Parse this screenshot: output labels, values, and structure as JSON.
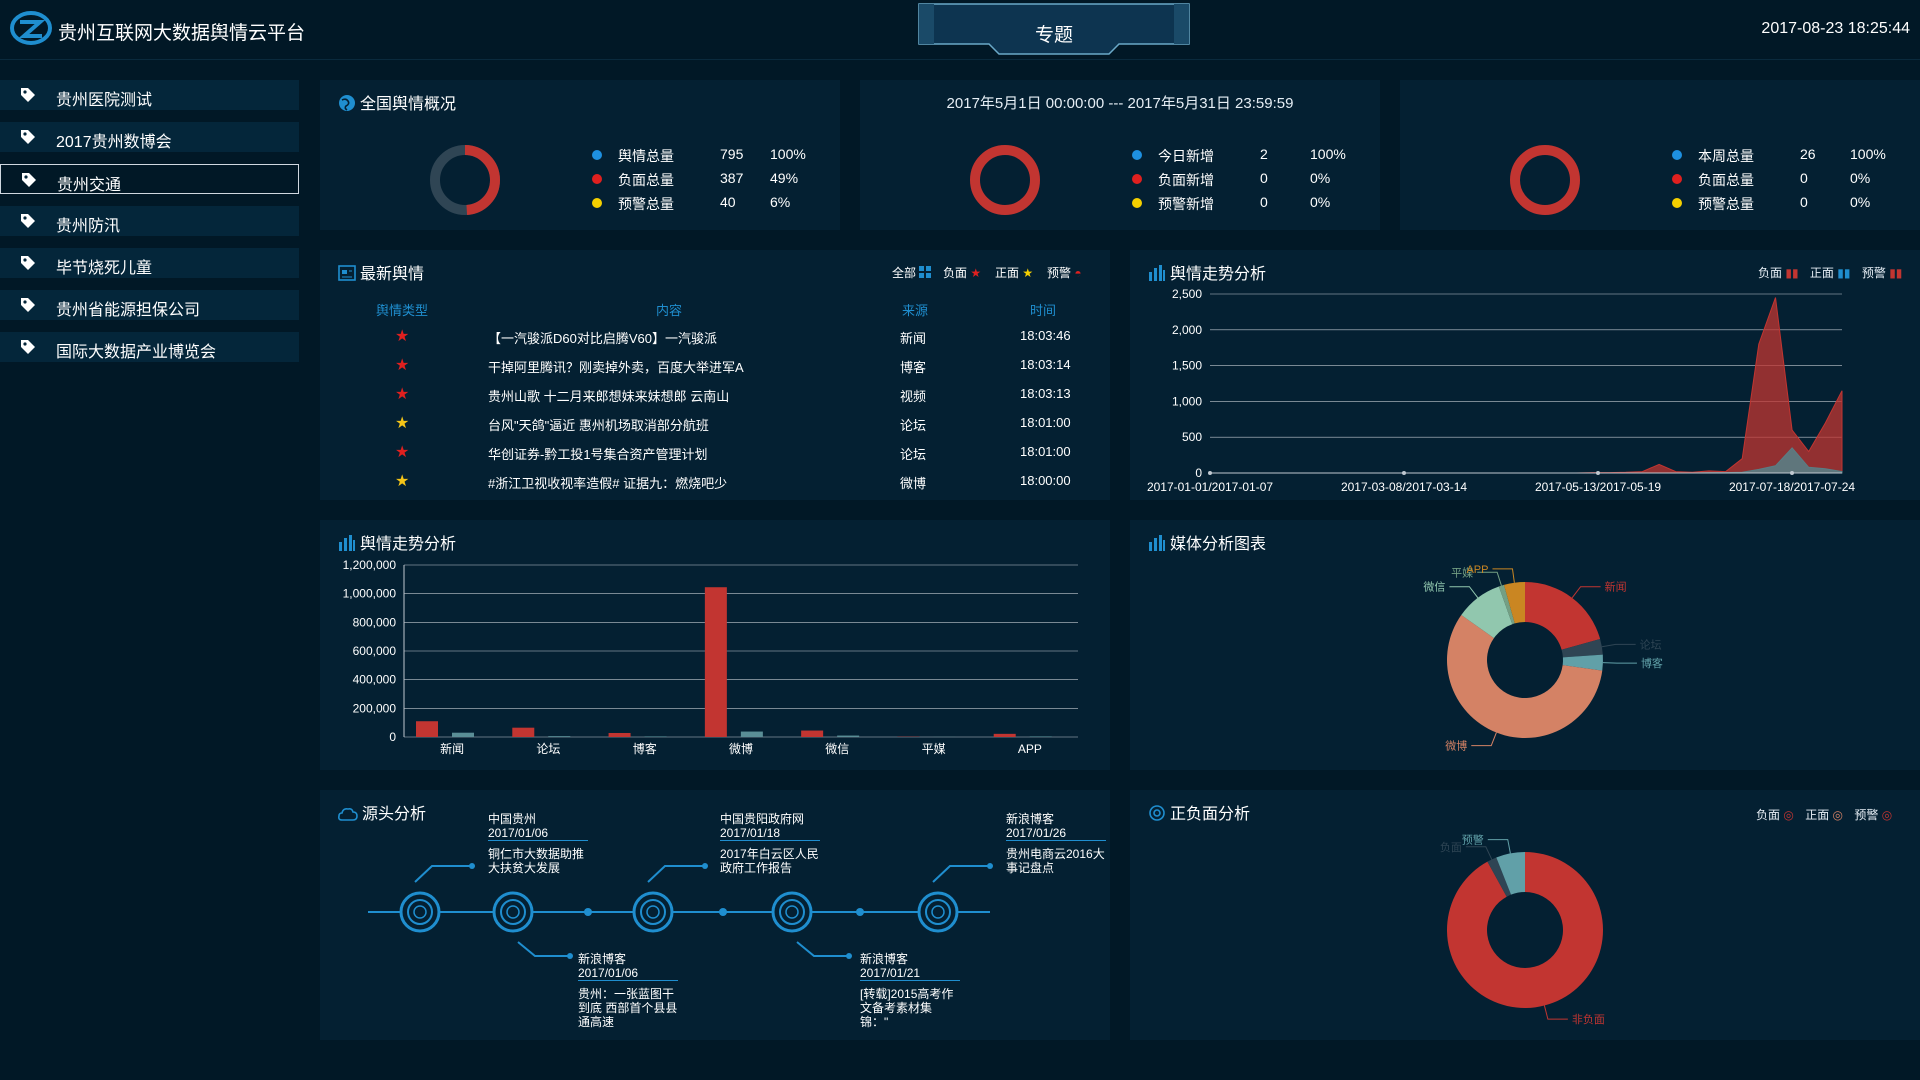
{
  "header": {
    "title": "贵州互联网大数据舆情云平台",
    "center_tab": "专题",
    "datetime": "2017-08-23 18:25:44"
  },
  "sidebar": {
    "items": [
      {
        "label": "贵州医院测试",
        "active": false
      },
      {
        "label": "2017贵州数博会",
        "active": false
      },
      {
        "label": "贵州交通",
        "active": true
      },
      {
        "label": "贵州防汛",
        "active": false
      },
      {
        "label": "毕节烧死儿童",
        "active": false
      },
      {
        "label": "贵州省能源担保公司",
        "active": false
      },
      {
        "label": "国际大数据产业博览会",
        "active": false
      }
    ]
  },
  "overview": {
    "title": "全国舆情概况",
    "date_range": "2017年5月1日 00:00:00 --- 2017年5月31日 23:59:59",
    "groups": [
      {
        "rows": [
          {
            "label": "舆情总量",
            "value": "795",
            "pct": "100%",
            "color": "#1e90e0"
          },
          {
            "label": "负面总量",
            "value": "387",
            "pct": "49%",
            "color": "#e0201f"
          },
          {
            "label": "预警总量",
            "value": "40",
            "pct": "6%",
            "color": "#f5d000"
          }
        ]
      },
      {
        "rows": [
          {
            "label": "今日新增",
            "value": "2",
            "pct": "100%",
            "color": "#1e90e0"
          },
          {
            "label": "负面新增",
            "value": "0",
            "pct": "0%",
            "color": "#e0201f"
          },
          {
            "label": "预警新增",
            "value": "0",
            "pct": "0%",
            "color": "#f5d000"
          }
        ]
      },
      {
        "rows": [
          {
            "label": "本周总量",
            "value": "26",
            "pct": "100%",
            "color": "#1e90e0"
          },
          {
            "label": "负面总量",
            "value": "0",
            "pct": "0%",
            "color": "#e0201f"
          },
          {
            "label": "预警总量",
            "value": "0",
            "pct": "0%",
            "color": "#f5d000"
          }
        ]
      }
    ]
  },
  "latest": {
    "title": "最新舆情",
    "filters": [
      "全部",
      "负面",
      "正面",
      "预警"
    ],
    "headers": {
      "type": "舆情类型",
      "content": "内容",
      "source": "来源",
      "time": "时间"
    },
    "rows": [
      {
        "star": "red",
        "content": "【一汽骏派D60对比启腾V60】一汽骏派",
        "source": "新闻",
        "time": "18:03:46"
      },
      {
        "star": "red",
        "content": "干掉阿里腾讯？刚卖掉外卖，百度大举进军A",
        "source": "博客",
        "time": "18:03:14"
      },
      {
        "star": "red",
        "content": "贵州山歌 十二月来郎想妹来妹想郎 云南山",
        "source": "视频",
        "time": "18:03:13"
      },
      {
        "star": "yellow",
        "content": "台风\"天鸽\"逼近 惠州机场取消部分航班",
        "source": "论坛",
        "time": "18:01:00"
      },
      {
        "star": "red",
        "content": "华创证券-黔工投1号集合资产管理计划",
        "source": "论坛",
        "time": "18:01:00"
      },
      {
        "star": "yellow",
        "content": "#浙江卫视收视率造假# 证据九：燃烧吧少",
        "source": "微博",
        "time": "18:00:00"
      }
    ]
  },
  "trend": {
    "title": "舆情走势分析",
    "legend": [
      "负面",
      "正面",
      "预警"
    ]
  },
  "bar_panel": {
    "title": "舆情走势分析"
  },
  "media": {
    "title": "媒体分析图表"
  },
  "source": {
    "title": "源头分析",
    "events": [
      {
        "site": "中国贵州",
        "date": "2017/01/06",
        "text": [
          "铜仁市大数据助推",
          "大扶贫大发展"
        ]
      },
      {
        "site": "新浪博客",
        "date": "2017/01/06",
        "text": [
          "贵州：一张蓝图干",
          "到底 西部首个县县",
          "通高速"
        ]
      },
      {
        "site": "中国贵阳政府网",
        "date": "2017/01/18",
        "text": [
          "2017年白云区人民",
          "政府工作报告"
        ]
      },
      {
        "site": "新浪博客",
        "date": "2017/01/21",
        "text": [
          "[转载]2015高考作",
          "文备考素材集",
          "锦：\""
        ]
      },
      {
        "site": "新浪博客",
        "date": "2017/01/26",
        "text": [
          "贵州电商云2016大",
          "事记盘点"
        ]
      }
    ]
  },
  "sentiment": {
    "title": "正负面分析",
    "legend": [
      "负面",
      "正面",
      "预警"
    ],
    "labels": {
      "warn": "预警",
      "neg": "负面",
      "nonneg": "非负面"
    },
    "colors": {
      "nonneg": "#c23531",
      "warn": "#61a0a8",
      "neg": "#2f4554"
    }
  },
  "chart_data": [
    {
      "type": "area",
      "title": "舆情走势分析",
      "x_tick_labels": [
        "2017-01-01/2017-01-07",
        "2017-03-08/2017-03-14",
        "2017-05-13/2017-05-19",
        "2017-07-18/2017-07-24"
      ],
      "ylim": [
        0,
        2500
      ],
      "y_ticks": [
        0,
        500,
        1000,
        1500,
        2000,
        2500
      ],
      "series": [
        {
          "name": "负面",
          "color": "#c23531",
          "values": [
            0,
            0,
            0,
            0,
            0,
            0,
            0,
            0,
            0,
            0,
            0,
            0,
            0,
            0,
            0,
            0,
            0,
            0,
            0,
            0,
            0,
            0,
            0,
            5,
            5,
            10,
            20,
            120,
            20,
            10,
            30,
            20,
            200,
            1800,
            2450,
            600,
            300,
            700,
            1150
          ]
        },
        {
          "name": "正面",
          "color": "#5a7e85",
          "values": [
            0,
            0,
            0,
            0,
            0,
            0,
            0,
            0,
            0,
            0,
            0,
            0,
            0,
            0,
            0,
            0,
            0,
            0,
            0,
            0,
            0,
            0,
            0,
            0,
            0,
            0,
            0,
            0,
            0,
            0,
            5,
            5,
            10,
            50,
            100,
            350,
            80,
            60,
            20
          ]
        }
      ]
    },
    {
      "type": "bar",
      "title": "舆情走势分析",
      "categories": [
        "新闻",
        "论坛",
        "博客",
        "微博",
        "微信",
        "平媒",
        "APP"
      ],
      "ylim": [
        0,
        1200000
      ],
      "y_ticks": [
        0,
        200000,
        400000,
        600000,
        800000,
        1000000,
        1200000
      ],
      "series": [
        {
          "name": "负面",
          "color": "#c23531",
          "values": [
            110000,
            65000,
            28000,
            1045000,
            45000,
            2000,
            22000
          ]
        },
        {
          "name": "正面",
          "color": "#5a8e96",
          "values": [
            30000,
            6000,
            4000,
            38000,
            10000,
            1000,
            4000
          ]
        }
      ]
    },
    {
      "type": "pie",
      "title": "媒体分析图表",
      "slices": [
        {
          "label": "新闻",
          "value": 19,
          "color": "#c23531"
        },
        {
          "label": "论坛",
          "value": 3,
          "color": "#2f4554"
        },
        {
          "label": "博客",
          "value": 3,
          "color": "#61a0a8"
        },
        {
          "label": "微博",
          "value": 53,
          "color": "#d48265"
        },
        {
          "label": "微信",
          "value": 9,
          "color": "#91c7ae"
        },
        {
          "label": "平媒",
          "value": 1,
          "color": "#749f83"
        },
        {
          "label": "APP",
          "value": 4,
          "color": "#ca8622"
        }
      ]
    },
    {
      "type": "pie",
      "title": "正负面分析",
      "slices": [
        {
          "label": "非负面",
          "value": 92,
          "color": "#c23531"
        },
        {
          "label": "负面",
          "value": 2,
          "color": "#2f4554"
        },
        {
          "label": "预警",
          "value": 6,
          "color": "#61a0a8"
        }
      ]
    }
  ]
}
